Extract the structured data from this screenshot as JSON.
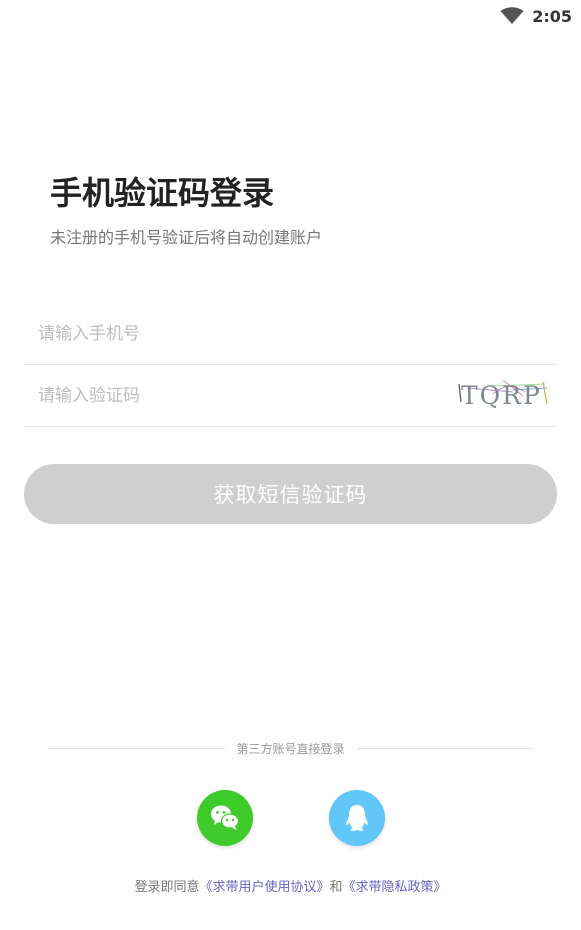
{
  "status_bar": {
    "time": "2:05"
  },
  "header": {
    "title": "手机验证码登录",
    "subtitle": "未注册的手机号验证后将自动创建账户"
  },
  "form": {
    "phone_placeholder": "请输入手机号",
    "code_placeholder": "请输入验证码",
    "captcha_text": "TQRP",
    "get_code_label": "获取短信验证码"
  },
  "third_party": {
    "divider_text": "第三方账号直接登录",
    "wechat_icon": "wechat-icon",
    "qq_icon": "qq-icon"
  },
  "agreement": {
    "prefix": "登录即同意",
    "user_agreement": "《求带用户使用协议》",
    "connector": "和",
    "privacy_policy": "《求带隐私政策》"
  },
  "colors": {
    "button_disabled": "#cfcfcf",
    "wechat": "#3fcb2c",
    "qq": "#61c6f8",
    "link": "#6b63c6"
  }
}
